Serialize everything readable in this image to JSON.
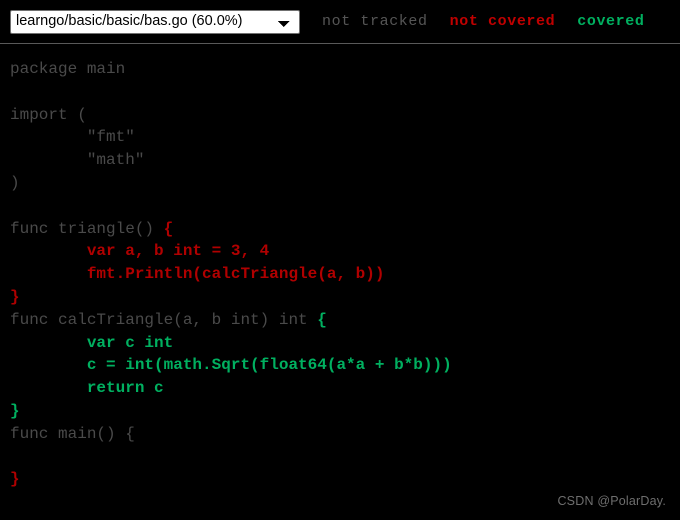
{
  "header": {
    "file_selector": {
      "selected": "learngo/basic/basic/bas.go (60.0%)",
      "options": [
        "learngo/basic/basic/bas.go (60.0%)"
      ]
    },
    "legend": {
      "not_tracked": "not tracked",
      "not_covered": "not covered",
      "covered": "covered"
    }
  },
  "colors": {
    "background": "#000000",
    "not_tracked": "#4a4a4a",
    "not_covered": "#b00000",
    "covered": "#00b060",
    "divider": "#595959",
    "select_background": "#ffffff",
    "select_text": "#000000"
  },
  "code": {
    "language": "go",
    "lines": [
      {
        "id": 1,
        "coverage": "not-tracked",
        "text": "package main"
      },
      {
        "id": 2,
        "coverage": "not-tracked",
        "text": ""
      },
      {
        "id": 3,
        "coverage": "not-tracked",
        "text": "import ("
      },
      {
        "id": 4,
        "coverage": "not-tracked",
        "text": "        \"fmt\""
      },
      {
        "id": 5,
        "coverage": "not-tracked",
        "text": "        \"math\""
      },
      {
        "id": 6,
        "coverage": "not-tracked",
        "text": ")"
      },
      {
        "id": 7,
        "coverage": "not-tracked",
        "text": ""
      },
      {
        "id": 8,
        "coverage": "mixed",
        "prefix": "func triangle() ",
        "marked": "{",
        "marked_coverage": "not-covered"
      },
      {
        "id": 9,
        "coverage": "not-covered",
        "indent": "        ",
        "text": "var a, b int = 3, 4"
      },
      {
        "id": 10,
        "coverage": "not-covered",
        "indent": "        ",
        "text": "fmt.Println(calcTriangle(a, b))"
      },
      {
        "id": 11,
        "coverage": "not-covered",
        "text": "}"
      },
      {
        "id": 12,
        "coverage": "mixed",
        "prefix": "func calcTriangle(a, b int) int ",
        "marked": "{",
        "marked_coverage": "covered"
      },
      {
        "id": 13,
        "coverage": "covered",
        "indent": "        ",
        "text": "var c int"
      },
      {
        "id": 14,
        "coverage": "covered",
        "indent": "        ",
        "text": "c = int(math.Sqrt(float64(a*a + b*b)))"
      },
      {
        "id": 15,
        "coverage": "covered",
        "indent": "        ",
        "text": "return c"
      },
      {
        "id": 16,
        "coverage": "covered",
        "text": "}"
      },
      {
        "id": 17,
        "coverage": "not-tracked",
        "text": "func main() {"
      },
      {
        "id": 18,
        "coverage": "not-tracked",
        "text": ""
      },
      {
        "id": 19,
        "coverage": "not-covered",
        "text": "}"
      }
    ]
  },
  "watermark": {
    "text": "CSDN @PolarDay."
  }
}
